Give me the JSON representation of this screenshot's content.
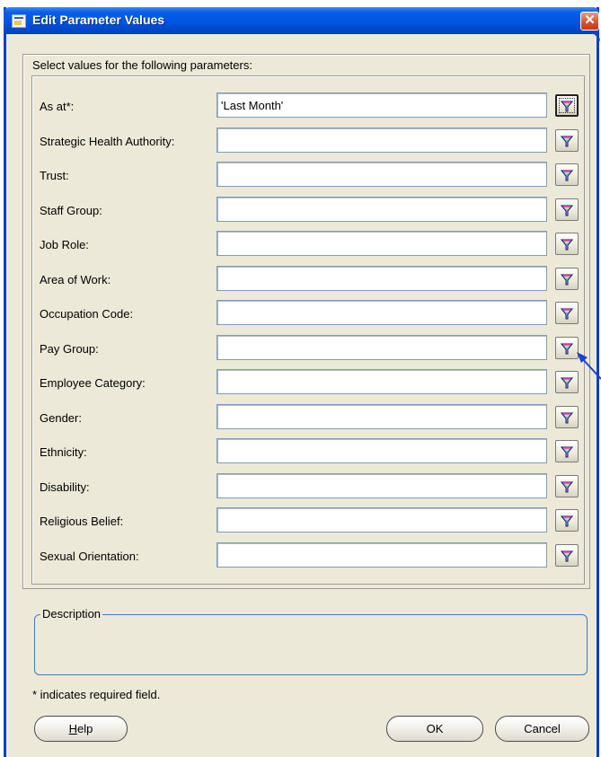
{
  "window": {
    "title": "Edit Parameter Values",
    "close_label": "✕"
  },
  "instruction": "Select values for the following parameters:",
  "parameters": [
    {
      "label": "As at*:",
      "value": "'Last Month'"
    },
    {
      "label": "Strategic Health Authority:",
      "value": ""
    },
    {
      "label": "Trust:",
      "value": ""
    },
    {
      "label": "Staff Group:",
      "value": ""
    },
    {
      "label": "Job Role:",
      "value": ""
    },
    {
      "label": "Area of Work:",
      "value": ""
    },
    {
      "label": "Occupation Code:",
      "value": ""
    },
    {
      "label": "Pay Group:",
      "value": ""
    },
    {
      "label": "Employee Category:",
      "value": ""
    },
    {
      "label": "Gender:",
      "value": ""
    },
    {
      "label": "Ethnicity:",
      "value": ""
    },
    {
      "label": "Disability:",
      "value": ""
    },
    {
      "label": "Religious Belief:",
      "value": ""
    },
    {
      "label": "Sexual Orientation:",
      "value": ""
    }
  ],
  "description": {
    "legend": "Description"
  },
  "required_note": "* indicates required field.",
  "buttons": {
    "help": {
      "prefix": "",
      "mnemonic": "H",
      "rest": "elp"
    },
    "ok": "OK",
    "cancel": "Cancel"
  },
  "colors": {
    "titlebar": "#0054e3",
    "dialog_bg": "#ece9d8",
    "annotation_arrow": "#1a3fd8"
  },
  "icons": {
    "lov": "lov-picker-icon",
    "app": "form-window-icon"
  }
}
